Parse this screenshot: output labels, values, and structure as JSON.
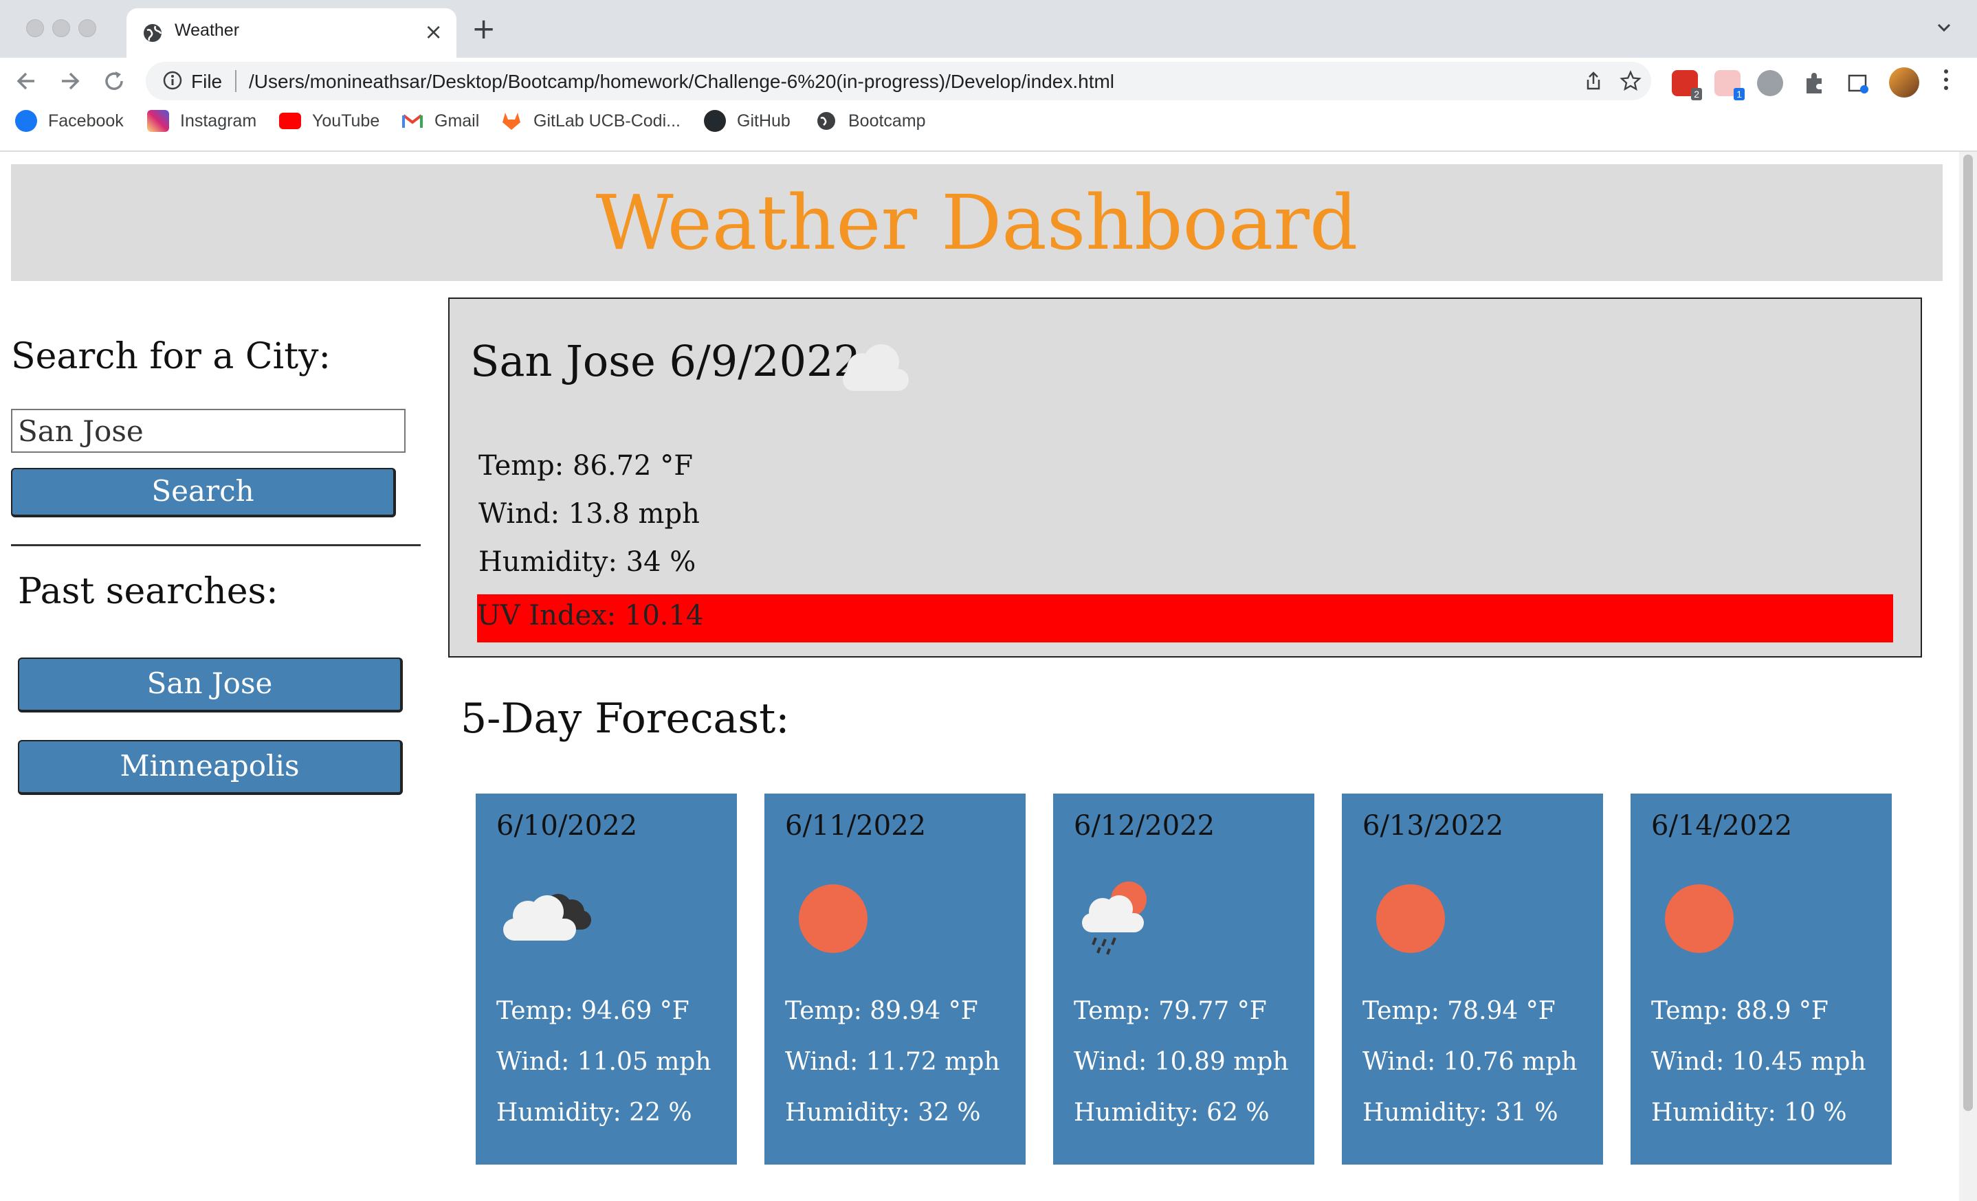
{
  "browser": {
    "tab_title": "Weather",
    "tab_close": "×",
    "new_tab": "+",
    "scheme_label": "File",
    "url": "/Users/monineathsar/Desktop/Bootcamp/homework/Challenge-6%20(in-progress)/Develop/index.html",
    "extension_badges": [
      "2",
      "1"
    ],
    "bookmarks": [
      {
        "label": "Facebook",
        "icon": "facebook-icon",
        "color": "#1877f2"
      },
      {
        "label": "Instagram",
        "icon": "instagram-icon",
        "color": "#d6249f"
      },
      {
        "label": "YouTube",
        "icon": "youtube-icon",
        "color": "#ff0000"
      },
      {
        "label": "Gmail",
        "icon": "gmail-icon",
        "color": "#ea4335"
      },
      {
        "label": "GitLab UCB-Codi...",
        "icon": "gitlab-icon",
        "color": "#fc6d26"
      },
      {
        "label": "GitHub",
        "icon": "github-icon",
        "color": "#24292e"
      },
      {
        "label": "Bootcamp",
        "icon": "globe-icon",
        "color": "#5f6368"
      }
    ]
  },
  "app": {
    "title": "Weather Dashboard",
    "title_color": "#f39423",
    "search_label": "Search for a City:",
    "search_value": "San Jose",
    "search_button": "Search",
    "past_label": "Past searches:",
    "past_searches": [
      "San Jose",
      "Minneapolis"
    ],
    "accent_color": "#4581b3"
  },
  "current": {
    "heading": "San Jose 6/9/2022",
    "icon": "cloud-icon",
    "temp": "Temp: 86.72 °F",
    "wind": "Wind: 13.8 mph",
    "humidity": "Humidity: 34 %",
    "uv": "UV Index: 10.14",
    "uv_color": "#ff0000"
  },
  "forecast": {
    "title": "5-Day Forecast:",
    "days": [
      {
        "date": "6/10/2022",
        "icon": "cloudy-icon",
        "temp": "Temp: 94.69 °F",
        "wind": "Wind: 11.05 mph",
        "humidity": "Humidity: 22 %"
      },
      {
        "date": "6/11/2022",
        "icon": "sun-icon",
        "temp": "Temp: 89.94 °F",
        "wind": "Wind: 11.72 mph",
        "humidity": "Humidity: 32 %"
      },
      {
        "date": "6/12/2022",
        "icon": "rain-icon",
        "temp": "Temp: 79.77 °F",
        "wind": "Wind: 10.89 mph",
        "humidity": "Humidity: 62 %"
      },
      {
        "date": "6/13/2022",
        "icon": "sun-icon",
        "temp": "Temp: 78.94 °F",
        "wind": "Wind: 10.76 mph",
        "humidity": "Humidity: 31 %"
      },
      {
        "date": "6/14/2022",
        "icon": "sun-icon",
        "temp": "Temp: 88.9 °F",
        "wind": "Wind: 10.45 mph",
        "humidity": "Humidity: 10 %"
      }
    ]
  }
}
